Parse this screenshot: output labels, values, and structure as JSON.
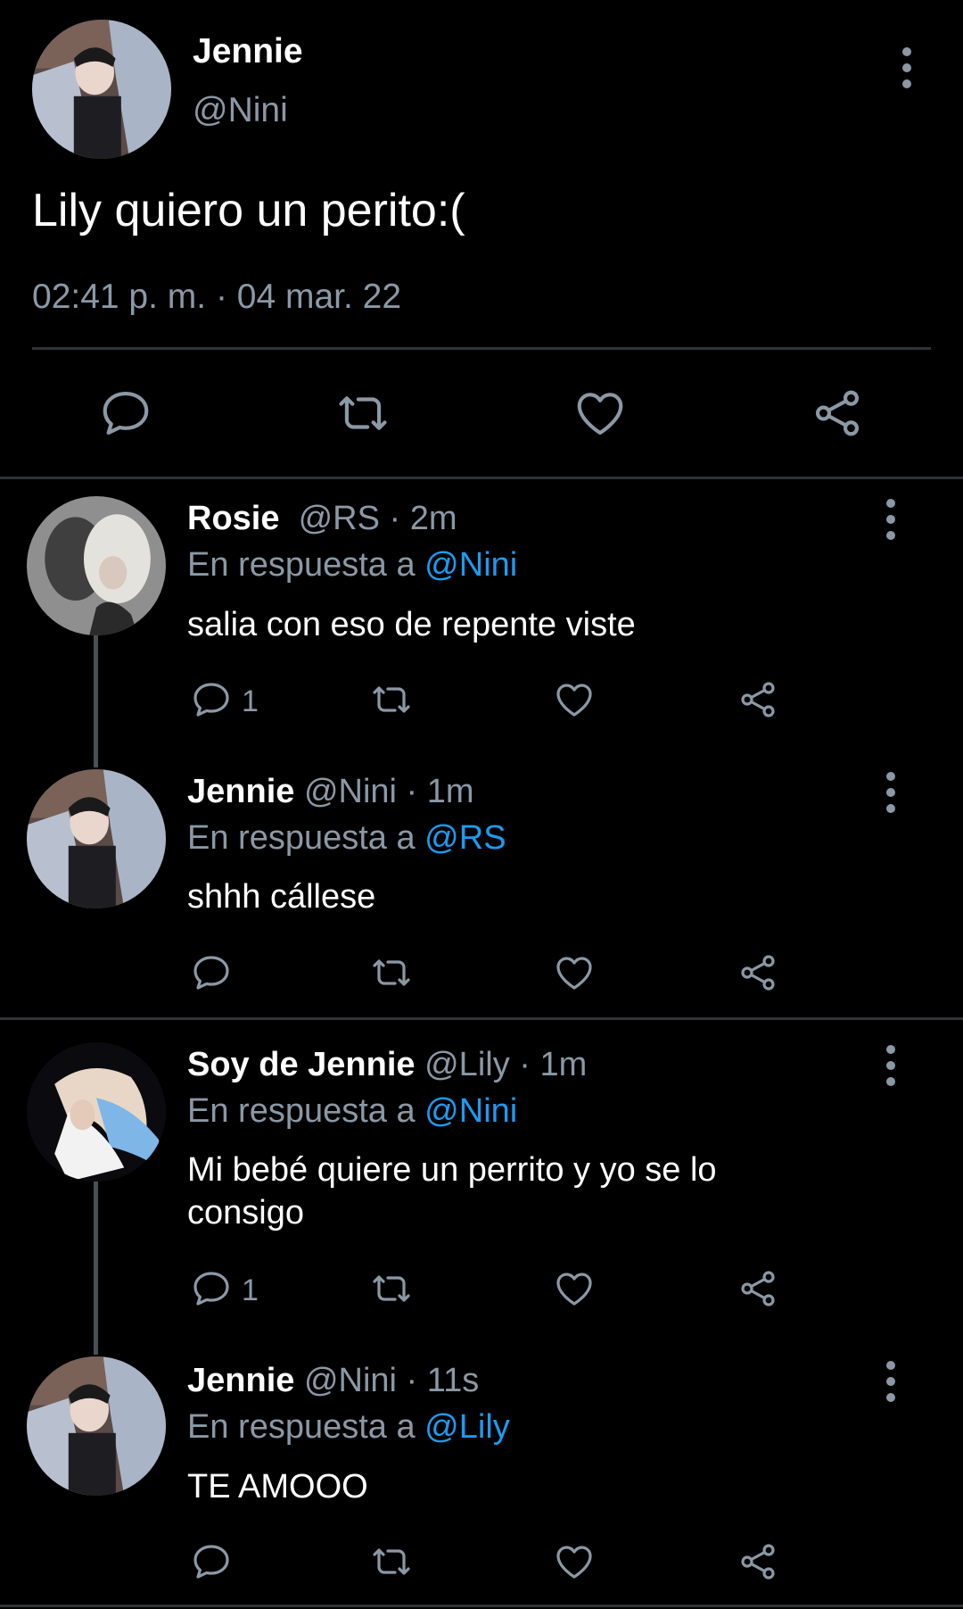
{
  "main_tweet": {
    "name": "Jennie",
    "handle": "@Nini",
    "text": "Lily quiero un perito:(",
    "timestamp": "02:41 p. m. · 04 mar. 22",
    "icons": [
      "reply-icon",
      "retweet-icon",
      "like-icon",
      "share-icon",
      "more-icon"
    ]
  },
  "replies": [
    {
      "name": "Rosie",
      "handle_time": "@RS · 2m",
      "replying_prefix": "En respuesta a",
      "replying_to": "@Nini",
      "text": "salia con eso de repente viste",
      "reply_count": "1"
    },
    {
      "name": "Jennie",
      "handle_time": "@Nini · 1m",
      "replying_prefix": "En respuesta a",
      "replying_to": "@RS",
      "text": "shhh cállese",
      "reply_count": ""
    },
    {
      "name": "Soy de Jennie",
      "handle_time": "@Lily · 1m",
      "replying_prefix": "En respuesta a",
      "replying_to": "@Nini",
      "text": "Mi bebé quiere un perrito y yo se lo consigo",
      "reply_count": "1"
    },
    {
      "name": "Jennie",
      "handle_time": "@Nini · 11s",
      "replying_prefix": "En respuesta a",
      "replying_to": "@Lily",
      "text": "TE AMOOO",
      "reply_count": ""
    }
  ],
  "colors": {
    "background": "#000000",
    "text": "#ffffff",
    "secondary": "#8b98a5",
    "mention": "#1d9bf0",
    "divider": "#2f3336"
  }
}
